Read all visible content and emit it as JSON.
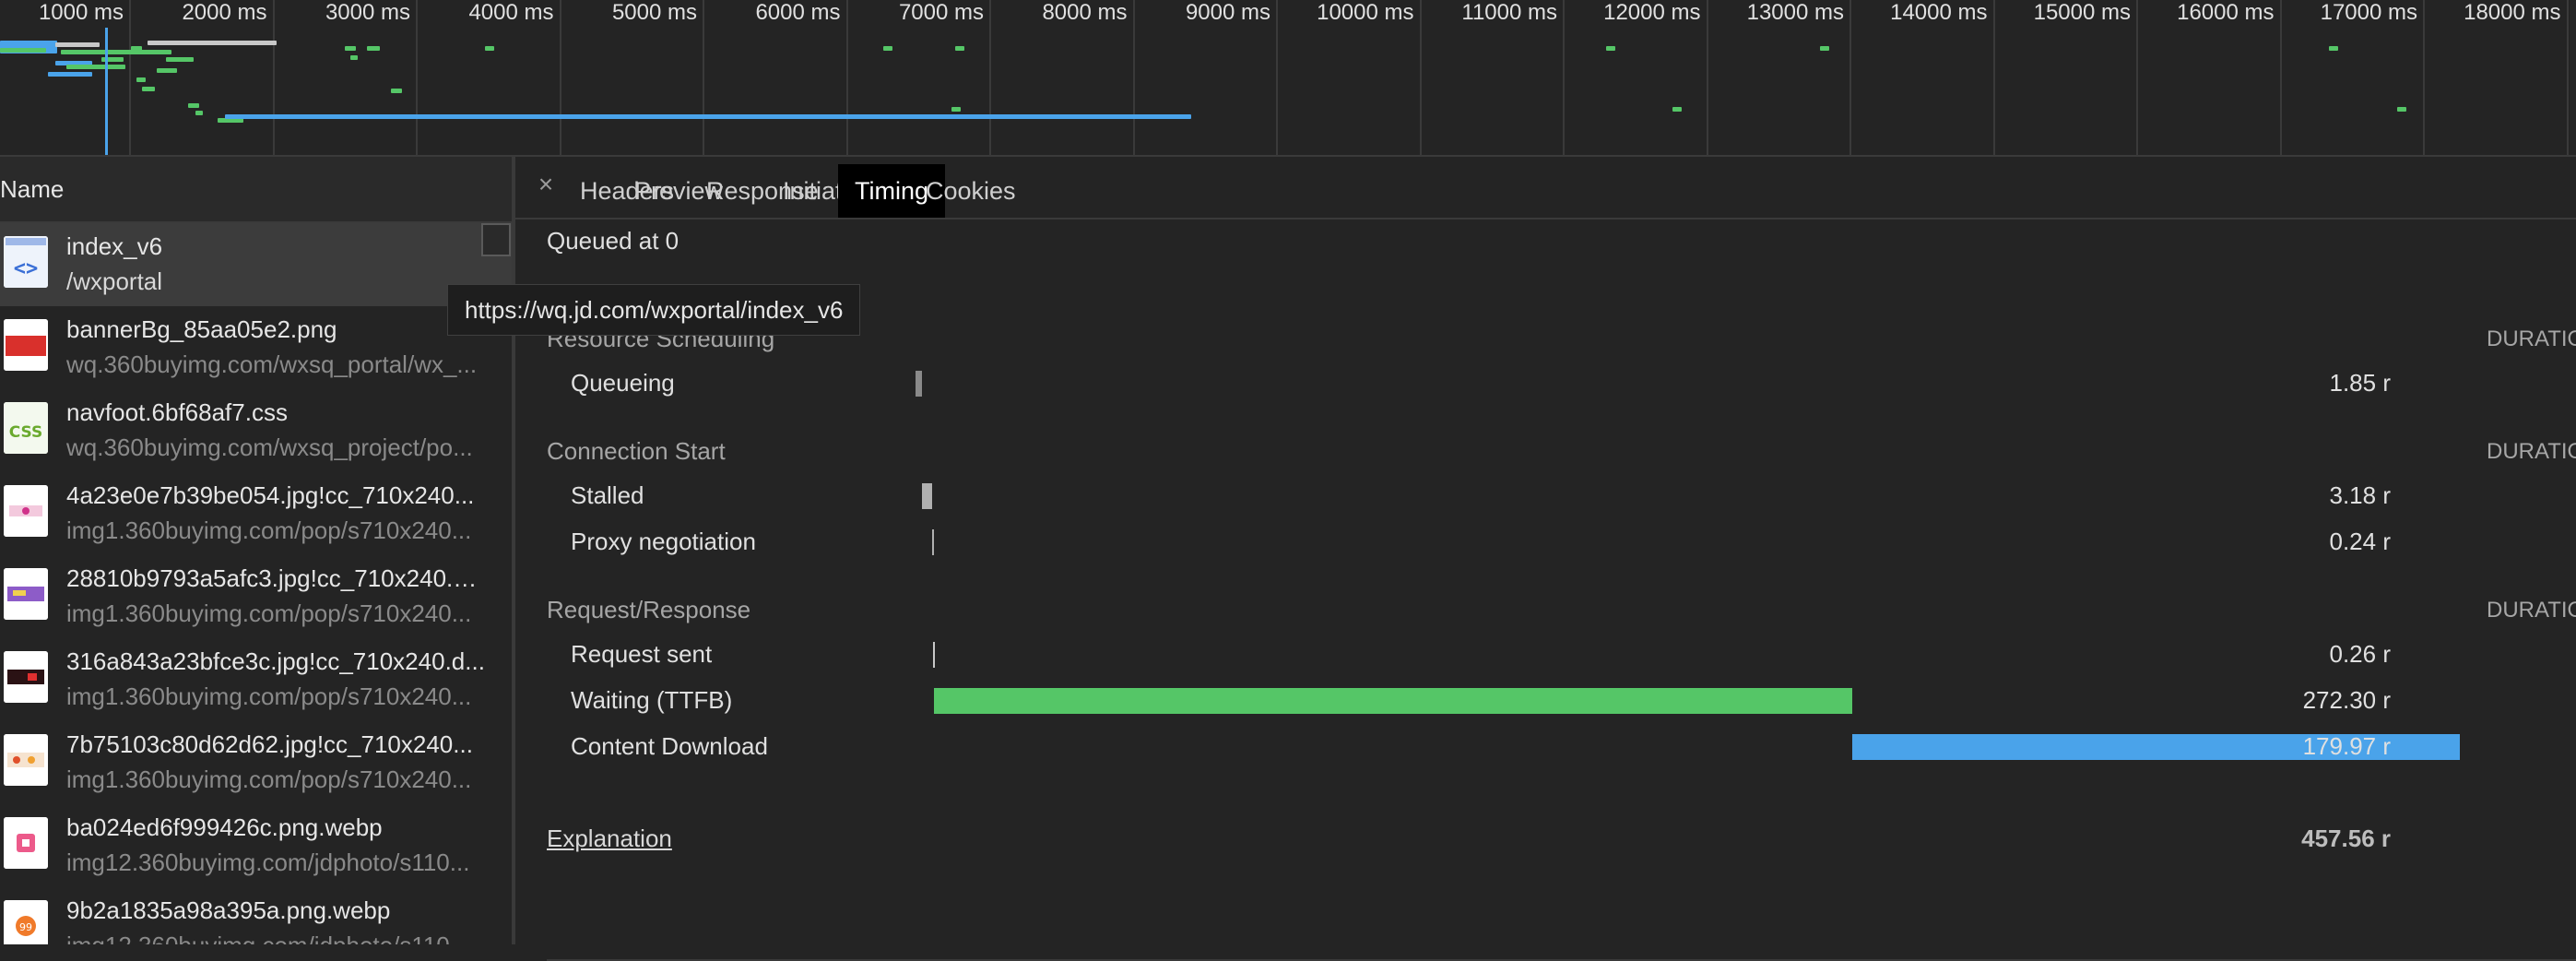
{
  "overview": {
    "ticks": [
      "1000 ms",
      "2000 ms",
      "3000 ms",
      "4000 ms",
      "5000 ms",
      "6000 ms",
      "7000 ms",
      "8000 ms",
      "9000 ms",
      "10000 ms",
      "11000 ms",
      "12000 ms",
      "13000 ms",
      "14000 ms",
      "15000 ms",
      "16000 ms",
      "17000 ms",
      "18000 ms"
    ]
  },
  "requests": {
    "column_header": "Name",
    "rows": [
      {
        "name": "index_v6",
        "url": "/wxportal",
        "thumb": "html-icon"
      },
      {
        "name": "bannerBg_85aa05e2.png",
        "url": "wq.360buyimg.com/wxsq_portal/wx_...",
        "thumb": "image-thumbnail"
      },
      {
        "name": "navfoot.6bf68af7.css",
        "url": "wq.360buyimg.com/wxsq_project/po...",
        "thumb": "css-icon"
      },
      {
        "name": "4a23e0e7b39be054.jpg!cc_710x240...",
        "url": "img1.360buyimg.com/pop/s710x240...",
        "thumb": "image-thumbnail"
      },
      {
        "name": "28810b9793a5afc3.jpg!cc_710x240.d...",
        "url": "img1.360buyimg.com/pop/s710x240...",
        "thumb": "image-thumbnail"
      },
      {
        "name": "316a843a23bfce3c.jpg!cc_710x240.d...",
        "url": "img1.360buyimg.com/pop/s710x240...",
        "thumb": "image-thumbnail"
      },
      {
        "name": "7b75103c80d62d62.jpg!cc_710x240...",
        "url": "img1.360buyimg.com/pop/s710x240...",
        "thumb": "image-thumbnail"
      },
      {
        "name": "ba024ed6f999426c.png.webp",
        "url": "img12.360buyimg.com/jdphoto/s110...",
        "thumb": "image-thumbnail"
      },
      {
        "name": "9b2a1835a98a395a.png.webp",
        "url": "img12.360buyimg.com/jdphoto/s110...",
        "thumb": "image-thumbnail"
      }
    ]
  },
  "tooltip": "https://wq.jd.com/wxportal/index_v6",
  "tabs": {
    "close": "×",
    "items": [
      "Headers",
      "Preview",
      "Response",
      "Initiator",
      "Timing",
      "Cookies"
    ],
    "active": "Timing"
  },
  "timing": {
    "queued_at": "Queued at 0",
    "sections": [
      {
        "title": "Resource Scheduling",
        "duration_header": "DURATIO",
        "phases": [
          {
            "label": "Queueing",
            "value": "1.85 r",
            "start_ms": 0,
            "dur_ms": 1.85,
            "color": "#8a8a8a"
          }
        ]
      },
      {
        "title": "Connection Start",
        "duration_header": "DURATIO",
        "phases": [
          {
            "label": "Stalled",
            "value": "3.18 r",
            "start_ms": 1.85,
            "dur_ms": 3.18,
            "color": "#b0b0b0"
          },
          {
            "label": "Proxy negotiation",
            "value": "0.24 r",
            "start_ms": 5.03,
            "dur_ms": 0.24,
            "color": "#b0b0b0"
          }
        ]
      },
      {
        "title": "Request/Response",
        "duration_header": "DURATIO",
        "phases": [
          {
            "label": "Request sent",
            "value": "0.26 r",
            "start_ms": 5.27,
            "dur_ms": 0.26,
            "color": "#c8c8c8"
          },
          {
            "label": "Waiting (TTFB)",
            "value": "272.30 r",
            "start_ms": 5.53,
            "dur_ms": 272.3,
            "color": "#55c667"
          },
          {
            "label": "Content Download",
            "value": "179.97 r",
            "start_ms": 277.83,
            "dur_ms": 179.97,
            "color": "#4aa3ea"
          }
        ]
      }
    ],
    "explanation": "Explanation",
    "total": "457.56 r",
    "total_ms": 457.56
  }
}
